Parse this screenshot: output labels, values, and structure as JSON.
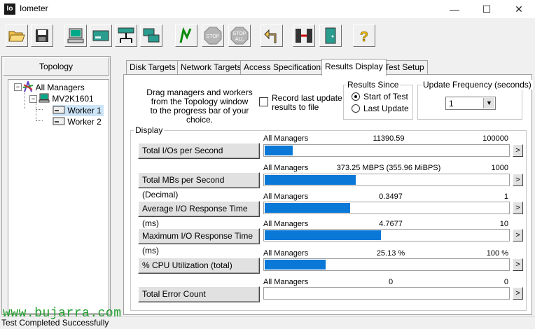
{
  "window": {
    "title": "Iometer",
    "app_icon": "Io"
  },
  "topology": {
    "header": "Topology",
    "tree": [
      {
        "label": "All Managers"
      },
      {
        "label": "MV2K1601"
      },
      {
        "label": "Worker 1"
      },
      {
        "label": "Worker 2"
      }
    ]
  },
  "tabs": [
    {
      "label": "Disk Targets"
    },
    {
      "label": "Network Targets"
    },
    {
      "label": "Access Specifications"
    },
    {
      "label": "Results Display"
    },
    {
      "label": "Test Setup"
    }
  ],
  "results": {
    "drag_text": [
      "Drag managers and workers",
      "from the Topology window",
      "to the progress bar of your choice."
    ],
    "record_label": [
      "Record last update",
      "results to file"
    ],
    "results_since": {
      "title": "Results Since",
      "options": [
        "Start of Test",
        "Last Update"
      ],
      "selected": "Start of Test"
    },
    "update_frequency": {
      "title": "Update Frequency (seconds)",
      "value": "1"
    },
    "display_label": "Display",
    "metrics": [
      {
        "name": "Total I/Os per Second",
        "source": "All Managers",
        "value": "11390.59",
        "max": "100000",
        "fill": 0.114
      },
      {
        "name": "Total MBs per Second (Decimal)",
        "source": "All Managers",
        "value": "373.25 MBPS (355.96 MiBPS)",
        "max": "1000",
        "fill": 0.373
      },
      {
        "name": "Average I/O Response Time (ms)",
        "source": "All Managers",
        "value": "0.3497",
        "max": "1",
        "fill": 0.35
      },
      {
        "name": "Maximum I/O Response Time (ms)",
        "source": "All Managers",
        "value": "4.7677",
        "max": "10",
        "fill": 0.477
      },
      {
        "name": "% CPU Utilization (total)",
        "source": "All Managers",
        "value": "25.13 %",
        "max": "100 %",
        "fill": 0.251
      },
      {
        "name": "Total Error Count",
        "source": "All Managers",
        "value": "0",
        "max": "0",
        "fill": 0
      }
    ],
    "arrow_glyph": ">"
  },
  "watermark": "www.bujarra.com",
  "status": "Test Completed Successfully",
  "colors": {
    "bar": "#0a78d7",
    "watermark": "#1f9d2a"
  }
}
